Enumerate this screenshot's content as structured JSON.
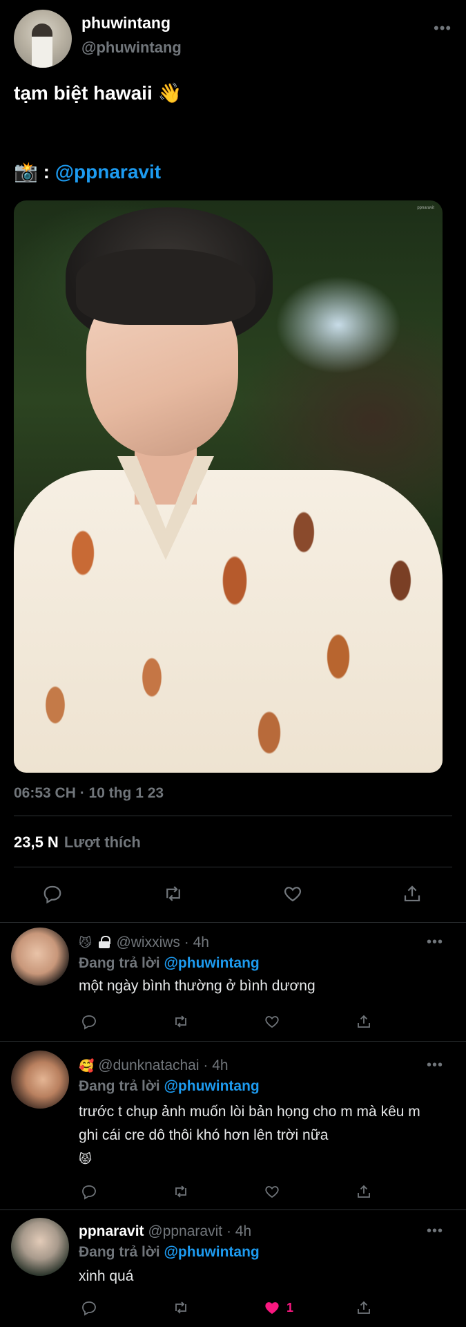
{
  "tweet": {
    "display_name": "phuwintang",
    "handle": "@phuwintang",
    "more": "•••",
    "text": "tạm biệt hawaii 👋",
    "credit_prefix": "📸 : ",
    "credit_mention": "@ppnaravit",
    "photo_watermark": "ppnaravit",
    "timestamp": "06:53 CH · 10 thg 1 23",
    "likes_count": "23,5 N",
    "likes_label": "Lượt thích",
    "actions": [
      "reply-icon",
      "retweet-icon",
      "like-icon",
      "share-icon"
    ]
  },
  "replies": [
    {
      "emoji_prefix": "😼",
      "name": "",
      "handle": "@wixxiws",
      "time": "4h",
      "replying_prefix": "Đang trả lời ",
      "replying_to": "@phuwintang",
      "body": "một ngày bình thường ở bình dương",
      "more": "•••",
      "likes": ""
    },
    {
      "emoji_prefix": "🥰",
      "name": "",
      "handle": "@dunknatachai",
      "time": "4h",
      "replying_prefix": "Đang trả lời ",
      "replying_to": "@phuwintang",
      "body": "trước t chụp ảnh muốn lòi bản họng cho m mà kêu m ghi cái cre dô thôi khó hơn lên trời nữa",
      "body_emoji": "😾",
      "more": "•••",
      "likes": ""
    },
    {
      "emoji_prefix": "",
      "name": "ppnaravit",
      "handle": "@ppnaravit",
      "time": "4h",
      "replying_prefix": "Đang trả lời ",
      "replying_to": "@phuwintang",
      "body": "xinh quá",
      "more": "•••",
      "likes": "1"
    }
  ],
  "colors": {
    "background": "#000000",
    "text": "#e7e9ea",
    "secondary": "#71767b",
    "accent": "#1d9bf0",
    "like": "#f91880",
    "divider": "#2f3336"
  }
}
